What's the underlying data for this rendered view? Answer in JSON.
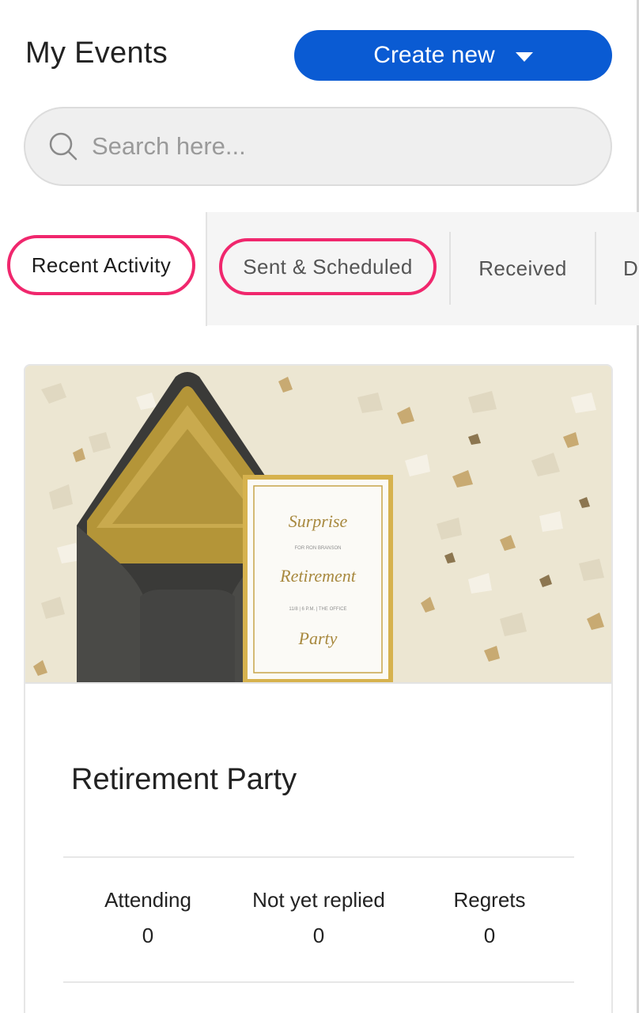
{
  "header": {
    "title": "My Events",
    "create_button_label": "Create new"
  },
  "search": {
    "placeholder": "Search here..."
  },
  "tabs": [
    {
      "label": "Recent Activity",
      "active": true
    },
    {
      "label": "Sent & Scheduled",
      "active": false
    },
    {
      "label": "Received",
      "active": false
    },
    {
      "label": "D",
      "active": false
    }
  ],
  "event": {
    "title": "Retirement Party",
    "invitation_lines": {
      "line1": "Surprise",
      "line2": "FOR RON BRANSON",
      "line3": "Retirement",
      "line4": "11/8  |  6 P.M.  |  THE OFFICE",
      "line5": "Party"
    },
    "stats": [
      {
        "label": "Attending",
        "value": "0"
      },
      {
        "label": "Not yet replied",
        "value": "0"
      },
      {
        "label": "Regrets",
        "value": "0"
      }
    ]
  },
  "colors": {
    "accent_blue": "#0a5bd3",
    "highlight_pink": "#f0276d",
    "gold": "#a8893f"
  }
}
